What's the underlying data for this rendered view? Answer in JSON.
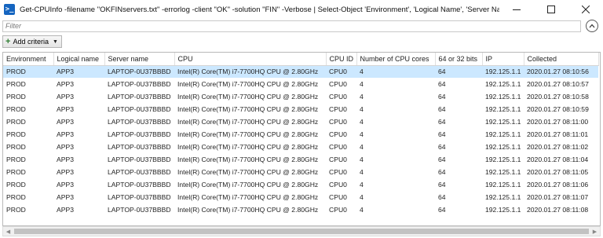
{
  "window": {
    "title": "Get-CPUInfo -filename \"OKFINservers.txt\" -errorlog -client \"OK\" -solution \"FIN\" -Verbose | Select-Object 'Environment', 'Logical Name', 'Server Name', 'CP...",
    "icon_glyph": ">_",
    "controls": [
      "minimize-icon",
      "maximize-icon",
      "close-icon"
    ]
  },
  "filter": {
    "placeholder": "Filter",
    "value": ""
  },
  "criteria": {
    "label": "Add criteria"
  },
  "table": {
    "columns": [
      "Environment",
      "Logical name",
      "Server name",
      "CPU",
      "CPU ID",
      "Number of CPU cores",
      "64 or 32 bits",
      "IP",
      "Collected"
    ],
    "selected_row": 0,
    "rows": [
      [
        "PROD",
        "APP3",
        "LAPTOP-0U37BBBD",
        "Intel(R) Core(TM) i7-7700HQ CPU @ 2.80GHz",
        "CPU0",
        "4",
        "64",
        "192.125.1.1",
        "2020.01.27 08:10:56"
      ],
      [
        "PROD",
        "APP3",
        "LAPTOP-0U37BBBD",
        "Intel(R) Core(TM) i7-7700HQ CPU @ 2.80GHz",
        "CPU0",
        "4",
        "64",
        "192.125.1.1",
        "2020.01.27 08:10:57"
      ],
      [
        "PROD",
        "APP3",
        "LAPTOP-0U37BBBD",
        "Intel(R) Core(TM) i7-7700HQ CPU @ 2.80GHz",
        "CPU0",
        "4",
        "64",
        "192.125.1.1",
        "2020.01.27 08:10:58"
      ],
      [
        "PROD",
        "APP3",
        "LAPTOP-0U37BBBD",
        "Intel(R) Core(TM) i7-7700HQ CPU @ 2.80GHz",
        "CPU0",
        "4",
        "64",
        "192.125.1.1",
        "2020.01.27 08:10:59"
      ],
      [
        "PROD",
        "APP3",
        "LAPTOP-0U37BBBD",
        "Intel(R) Core(TM) i7-7700HQ CPU @ 2.80GHz",
        "CPU0",
        "4",
        "64",
        "192.125.1.1",
        "2020.01.27 08:11:00"
      ],
      [
        "PROD",
        "APP3",
        "LAPTOP-0U37BBBD",
        "Intel(R) Core(TM) i7-7700HQ CPU @ 2.80GHz",
        "CPU0",
        "4",
        "64",
        "192.125.1.1",
        "2020.01.27 08:11:01"
      ],
      [
        "PROD",
        "APP3",
        "LAPTOP-0U37BBBD",
        "Intel(R) Core(TM) i7-7700HQ CPU @ 2.80GHz",
        "CPU0",
        "4",
        "64",
        "192.125.1.1",
        "2020.01.27 08:11:02"
      ],
      [
        "PROD",
        "APP3",
        "LAPTOP-0U37BBBD",
        "Intel(R) Core(TM) i7-7700HQ CPU @ 2.80GHz",
        "CPU0",
        "4",
        "64",
        "192.125.1.1",
        "2020.01.27 08:11:04"
      ],
      [
        "PROD",
        "APP3",
        "LAPTOP-0U37BBBD",
        "Intel(R) Core(TM) i7-7700HQ CPU @ 2.80GHz",
        "CPU0",
        "4",
        "64",
        "192.125.1.1",
        "2020.01.27 08:11:05"
      ],
      [
        "PROD",
        "APP3",
        "LAPTOP-0U37BBBD",
        "Intel(R) Core(TM) i7-7700HQ CPU @ 2.80GHz",
        "CPU0",
        "4",
        "64",
        "192.125.1.1",
        "2020.01.27 08:11:06"
      ],
      [
        "PROD",
        "APP3",
        "LAPTOP-0U37BBBD",
        "Intel(R) Core(TM) i7-7700HQ CPU @ 2.80GHz",
        "CPU0",
        "4",
        "64",
        "192.125.1.1",
        "2020.01.27 08:11:07"
      ],
      [
        "PROD",
        "APP3",
        "LAPTOP-0U37BBBD",
        "Intel(R) Core(TM) i7-7700HQ CPU @ 2.80GHz",
        "CPU0",
        "4",
        "64",
        "192.125.1.1",
        "2020.01.27 08:11:08"
      ]
    ]
  },
  "colors": {
    "selection": "#cce8ff",
    "icon_blue": "#1565c0",
    "plus_green": "#2e7d32",
    "grid_border": "#b9b9b9"
  }
}
